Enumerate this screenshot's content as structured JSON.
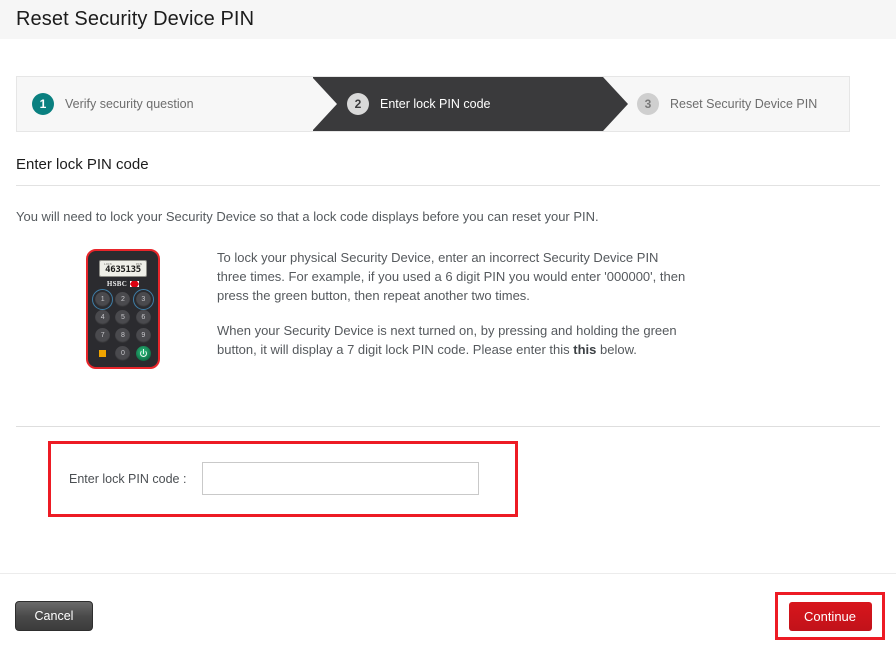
{
  "header": {
    "title": "Reset Security Device PIN"
  },
  "steps": [
    {
      "number": "1",
      "label": "Verify security question",
      "state": "done"
    },
    {
      "number": "2",
      "label": "Enter lock PIN code",
      "state": "current"
    },
    {
      "number": "3",
      "label": "Reset Security Device PIN",
      "state": "todo"
    }
  ],
  "section": {
    "title": "Enter lock PIN code",
    "intro": "You will need to lock your Security Device so that a lock code displays before you can reset your PIN."
  },
  "device": {
    "screen_code": "4635135",
    "screen_mini_left": "LOCK",
    "screen_mini_right": "PIN",
    "brand": "HSBC",
    "keys": [
      "1",
      "2",
      "3",
      "4",
      "5",
      "6",
      "7",
      "8",
      "9"
    ],
    "highlighted_keys": [
      "1",
      "3"
    ],
    "zero_key": "0",
    "square_key": "square-key",
    "power_key": "power-key"
  },
  "instructions": {
    "paragraph_1": "To lock your physical Security Device, enter an incorrect Security Device PIN three times. For example, if you used a 6 digit PIN you would enter '000000', then press the green button, then repeat another two times.",
    "paragraph_2_part_1": "When your Security Device is next turned on, by pressing and holding the green button, it will display a 7 digit lock PIN code. Please enter this ",
    "paragraph_2_bold": "this",
    "paragraph_2_part_2": " below."
  },
  "form": {
    "pin_label": "Enter lock PIN code :",
    "pin_value": "",
    "pin_placeholder": ""
  },
  "footer": {
    "cancel_label": "Cancel",
    "continue_label": "Continue"
  },
  "colors": {
    "accent_red": "#ed1b24",
    "step_done": "#0a8080",
    "step_current_bar": "#3a3a3c",
    "continue_button": "#c1121a"
  }
}
